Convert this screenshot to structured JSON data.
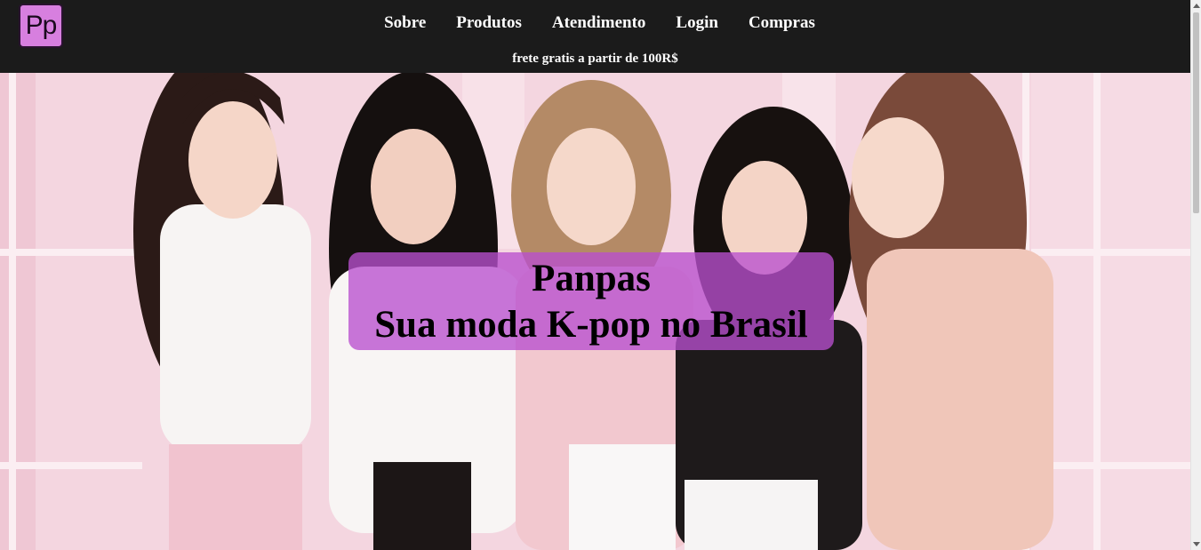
{
  "header": {
    "logo_text": "Pp",
    "nav": [
      {
        "label": "Sobre"
      },
      {
        "label": "Produtos"
      },
      {
        "label": "Atendimento"
      },
      {
        "label": "Login"
      },
      {
        "label": "Compras"
      }
    ],
    "promo_text": "frete gratis a partir de 100R$"
  },
  "hero": {
    "title": "Panpas",
    "subtitle": "Sua moda K-pop no Brasil"
  },
  "colors": {
    "header_bg": "#1b1b1b",
    "logo_bg": "#d77fdf",
    "caption_bg": "#b84fce",
    "hero_bg": "#f3d2de"
  }
}
